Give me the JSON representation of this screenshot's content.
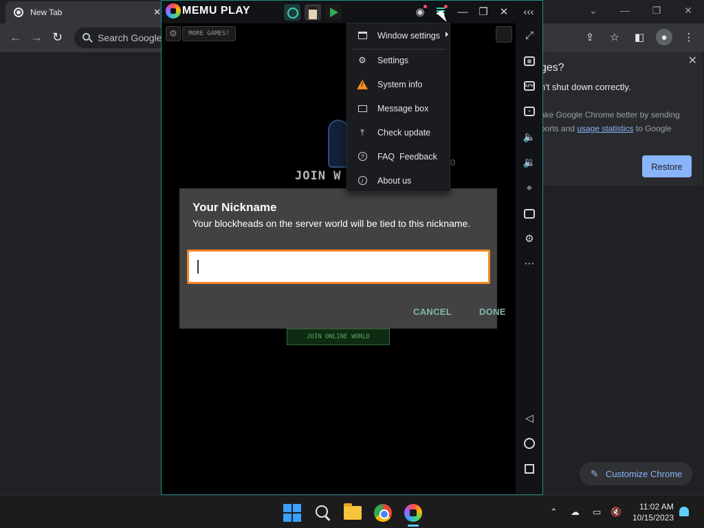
{
  "chrome": {
    "tab_title": "New Tab",
    "tab_close": "✕",
    "window_buttons": [
      "⌄",
      "—",
      "❐",
      "✕"
    ],
    "omnibox_placeholder": "Search Google",
    "restore_bubble": {
      "title_partial": "ges?",
      "line1": "n't shut down correctly.",
      "line2": "ake Google Chrome better by sending",
      "line3_prefix": "ports and ",
      "line3_link": "usage statistics",
      "line3_suffix": " to Google",
      "restore_label": "Restore",
      "close_glyph": "✕"
    },
    "customize_label": "Customize Chrome"
  },
  "memu": {
    "brand": "MEMU PLAY",
    "titlebar_icons": [
      "user-icon",
      "menu-icon",
      "minimize-icon",
      "restore-icon",
      "close-icon",
      "collapse-icon"
    ],
    "more_games": "MORE GAMES!",
    "join_text": "JOIN W",
    "join_text_right": "O",
    "join_online": "JOIN ONLINE WORLD",
    "menu": {
      "items": [
        {
          "label": "Window settings",
          "icon": "window-icon"
        },
        {
          "label": "Settings",
          "icon": "gear-icon"
        },
        {
          "label": "System info",
          "icon": "warning-icon"
        },
        {
          "label": "Message box",
          "icon": "mail-icon"
        },
        {
          "label": "Check update",
          "icon": "upload-icon"
        },
        {
          "label": "FAQ  Feedback",
          "icon": "help-icon"
        },
        {
          "label": "About us",
          "icon": "info-icon"
        }
      ]
    },
    "dialog": {
      "title": "Your Nickname",
      "description": "Your blockheads on the server world will be tied to this nickname.",
      "input_value": "",
      "cancel_label": "CANCEL",
      "done_label": "DONE"
    },
    "side_toolbar": [
      "fullscreen-icon",
      "keyboard-icon",
      "apk-icon",
      "multi-window-icon",
      "volume-up-icon",
      "volume-down-icon",
      "location-icon",
      "folder-icon",
      "settings-icon",
      "more-icon",
      "back-icon",
      "home-icon",
      "recents-icon"
    ]
  },
  "taskbar": {
    "time": "11:02 AM",
    "date": "10/15/2023"
  }
}
